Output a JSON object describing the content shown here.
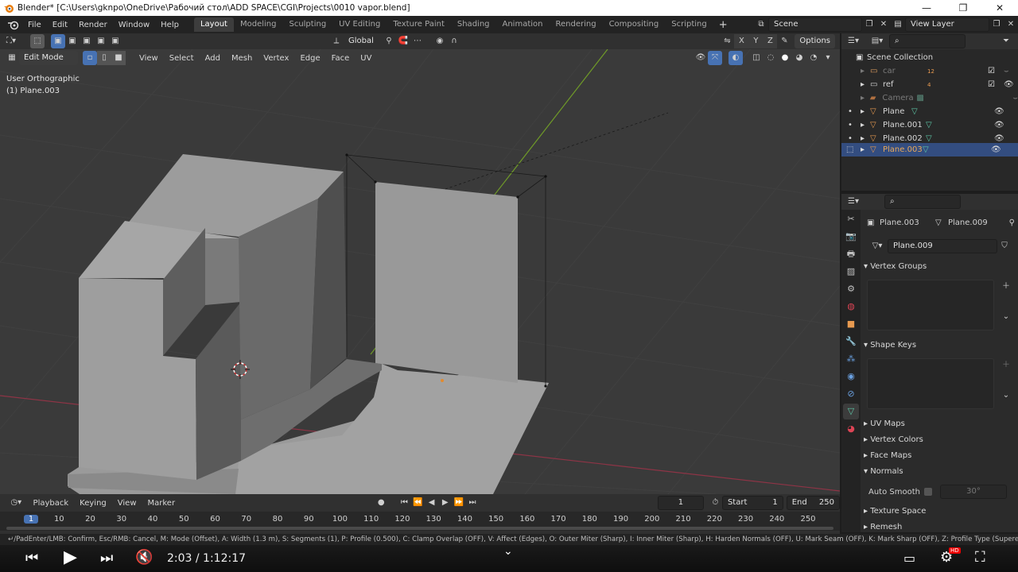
{
  "window": {
    "title": "Blender* [C:\\Users\\gknpo\\OneDrive\\Рабочий стол\\ADD SPACE\\CGI\\Projects\\0010 vapor.blend]",
    "minimize": "—",
    "maximize": "❐",
    "close": "✕"
  },
  "menubar": {
    "menus": [
      "File",
      "Edit",
      "Render",
      "Window",
      "Help"
    ],
    "workspaces": [
      "Layout",
      "Modeling",
      "Sculpting",
      "UV Editing",
      "Texture Paint",
      "Shading",
      "Animation",
      "Rendering",
      "Compositing",
      "Scripting"
    ],
    "active_workspace": "Layout",
    "add_workspace": "+",
    "scene": "Scene",
    "view_layer": "View Layer"
  },
  "viewport_header": {
    "transform_orientation": "Global",
    "options": "Options",
    "axes": [
      "X",
      "Y",
      "Z"
    ],
    "mode": "Edit Mode",
    "menus": [
      "View",
      "Select",
      "Add",
      "Mesh",
      "Vertex",
      "Edge",
      "Face",
      "UV"
    ]
  },
  "viewport": {
    "view_name": "User Orthographic",
    "object_name": "(1) Plane.003"
  },
  "outliner": {
    "root": "Scene Collection",
    "items": [
      {
        "name": "car",
        "dim": true,
        "selected": false
      },
      {
        "name": "ref",
        "dim": false,
        "selected": false
      },
      {
        "name": "Camera",
        "dim": true,
        "selected": false
      },
      {
        "name": "Plane",
        "dim": false,
        "selected": false
      },
      {
        "name": "Plane.001",
        "dim": false,
        "selected": false
      },
      {
        "name": "Plane.002",
        "dim": false,
        "selected": false
      },
      {
        "name": "Plane.003",
        "dim": false,
        "selected": true
      }
    ],
    "badge_car": "12",
    "badge_ref": "4"
  },
  "properties": {
    "object": "Plane.003",
    "mesh": "Plane.009",
    "mesh_field": "Plane.009",
    "panels": {
      "vertex_groups": "Vertex Groups",
      "shape_keys": "Shape Keys",
      "uv_maps": "UV Maps",
      "vertex_colors": "Vertex Colors",
      "face_maps": "Face Maps",
      "normals": "Normals",
      "auto_smooth": "Auto Smooth",
      "auto_smooth_angle": "30°",
      "texture_space": "Texture Space",
      "remesh": "Remesh"
    }
  },
  "timeline": {
    "menus": [
      "Playback",
      "Keying",
      "View",
      "Marker"
    ],
    "current_frame": "1",
    "start_label": "Start",
    "start": "1",
    "end_label": "End",
    "end": "250",
    "ticks": [
      "1",
      "10",
      "20",
      "30",
      "40",
      "50",
      "60",
      "70",
      "80",
      "90",
      "100",
      "110",
      "120",
      "130",
      "140",
      "150",
      "160",
      "170",
      "180",
      "190",
      "200",
      "210",
      "220",
      "230",
      "240",
      "250"
    ]
  },
  "statusbar": {
    "text": "↵/PadEnter/LMB: Confirm, Esc/RMB: Cancel, M: Mode (Offset), A: Width (1.3 m), S: Segments (1), P: Profile (0.500), C: Clamp Overlap (OFF), V: Affect (Edges), O: Outer Miter (Sharp), I: Inner Miter (Sharp), H: Harden Normals (OFF), U: Mark Seam (OFF), K: Mark Sharp (OFF), Z: Profile Type (Superellipse"
  },
  "player": {
    "time": "2:03 / 1:12:17",
    "hd": "HD"
  },
  "colors": {
    "accent": "#4772b3",
    "selected_row": "#334d80",
    "viewport_bg": "#3a3a3a",
    "x_axis": "#a0344a",
    "y_axis": "#7aa22a"
  }
}
